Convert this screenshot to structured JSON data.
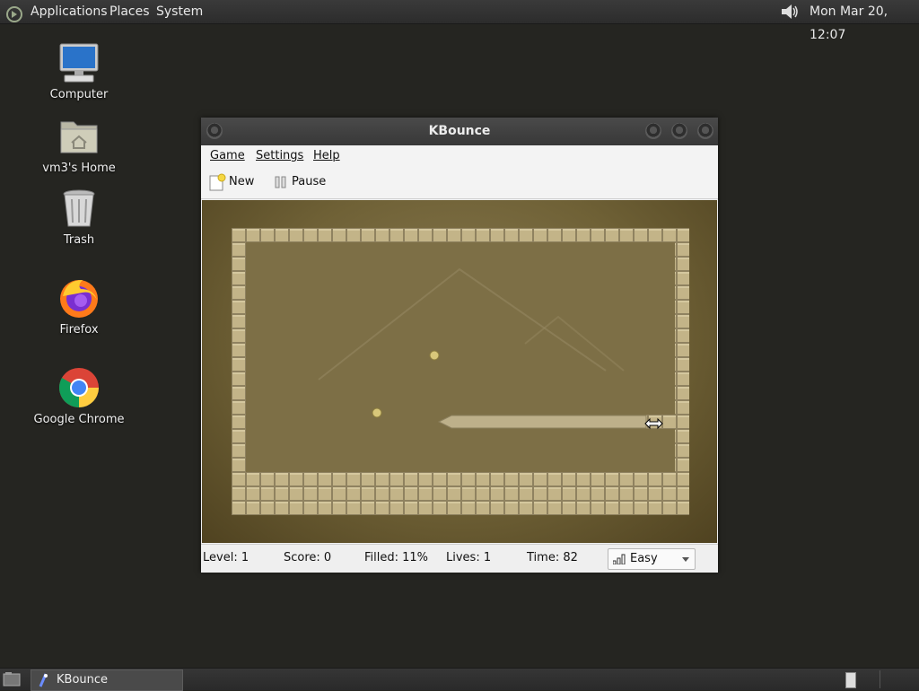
{
  "top_panel": {
    "menus": [
      "Applications",
      "Places",
      "System"
    ],
    "clock": "Mon Mar 20, 12:07"
  },
  "desktop_icons": [
    {
      "label": "Computer",
      "icon": "computer-icon"
    },
    {
      "label": "vm3's Home",
      "icon": "home-folder-icon"
    },
    {
      "label": "Trash",
      "icon": "trash-icon"
    },
    {
      "label": "Firefox",
      "icon": "firefox-icon"
    },
    {
      "label": "Google Chrome",
      "icon": "chrome-icon"
    }
  ],
  "window": {
    "title": "KBounce",
    "menu": [
      "Game",
      "Settings",
      "Help"
    ],
    "toolbar": {
      "new_label": "New",
      "pause_label": "Pause"
    },
    "status": {
      "level": "Level: 1",
      "score": "Score: 0",
      "filled": "Filled: 11%",
      "lives": "Lives: 1",
      "time": "Time: 82",
      "difficulty": "Easy"
    }
  },
  "taskbar": {
    "items": [
      {
        "label": "KBounce",
        "icon": "kbounce-icon"
      }
    ]
  },
  "colors": {
    "desktop_bg": "#252521",
    "panel_bg": "#2e2e2e",
    "tile": "#c3b488",
    "board": "#7d6f46"
  }
}
